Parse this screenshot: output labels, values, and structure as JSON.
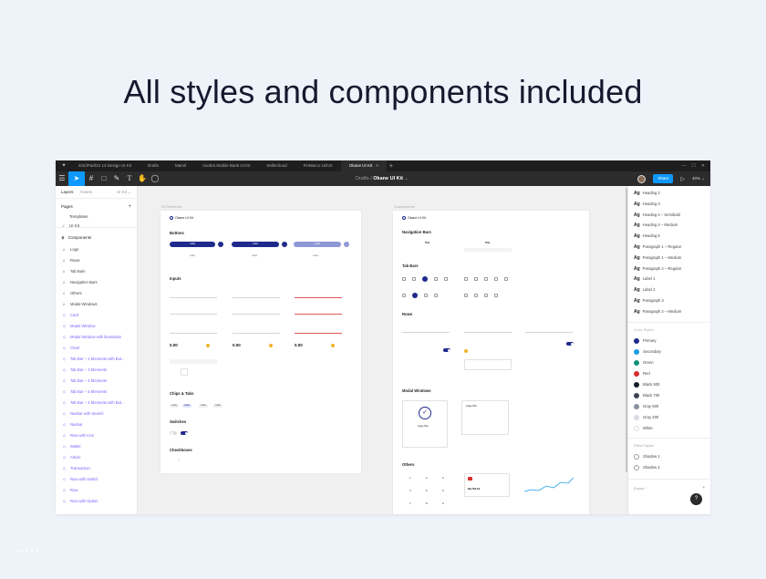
{
  "headline": "All styles and components included",
  "app": {
    "tabs": [
      {
        "label": "iOS/iPadOS 13 Design UI Kit"
      },
      {
        "label": "Drafts"
      },
      {
        "label": "Marvil"
      },
      {
        "label": "Vuokra Mobile Bank UI Kit"
      },
      {
        "label": "Sellercloud"
      },
      {
        "label": "FinMarco UI/UX"
      },
      {
        "label": "Okane UI Kit",
        "close": "×"
      }
    ],
    "tab_add": "+",
    "breadcrumb": {
      "folder": "Drafts",
      "sep": " / ",
      "file": "Okane UI Kit",
      "chevron": "⌄"
    },
    "share_label": "Share",
    "zoom": "40%",
    "accent": "#0d99ff"
  },
  "left_panel": {
    "tabs": [
      "Layers",
      "Assets"
    ],
    "kit_label": "UI Kit ⌄",
    "pages_title": "Pages",
    "pages": [
      "Templates",
      "UI Kit"
    ],
    "components_title": "Components",
    "components": [
      {
        "label": "Logo",
        "accent": false
      },
      {
        "label": "Rows",
        "accent": false
      },
      {
        "label": "Tab Bars",
        "accent": false
      },
      {
        "label": "Navigation Bars",
        "accent": false
      },
      {
        "label": "Others",
        "accent": false
      },
      {
        "label": "Modal Windows",
        "accent": false
      },
      {
        "label": "Card",
        "accent": true
      },
      {
        "label": "Modal Window",
        "accent": true
      },
      {
        "label": "Modal Window with Illustration",
        "accent": true
      },
      {
        "label": "Chart",
        "accent": true
      },
      {
        "label": "Tab Bar – 2 Elements with But...",
        "accent": true
      },
      {
        "label": "Tab Bar – 3 Elements",
        "accent": true
      },
      {
        "label": "Tab Bar – 4 Elements",
        "accent": true
      },
      {
        "label": "Tab Bar – 5 Elements",
        "accent": true
      },
      {
        "label": "Tab Bar – 4 Elements with But...",
        "accent": true
      },
      {
        "label": "Navbar with Search",
        "accent": true
      },
      {
        "label": "Navbar",
        "accent": true
      },
      {
        "label": "Row with Icon",
        "accent": true
      },
      {
        "label": "Wallet",
        "accent": true
      },
      {
        "label": "Article",
        "accent": true
      },
      {
        "label": "Transaction",
        "accent": true
      },
      {
        "label": "Row with Switch",
        "accent": true
      },
      {
        "label": "Row",
        "accent": true
      },
      {
        "label": "Row with Option",
        "accent": true
      }
    ]
  },
  "canvas": {
    "frame1": {
      "label": "UI Elements",
      "logo": "Okane UI Kit",
      "sections": [
        "Buttons",
        "Inputs",
        "Chips & Tabs",
        "Switches",
        "Checkboxes"
      ],
      "amounts": [
        "0.00",
        "0.00",
        "0.00",
        "0.00",
        "0.00",
        "0.00"
      ]
    },
    "frame2": {
      "label": "Components",
      "logo": "Okane UI Kit",
      "sections": [
        "Navigation Bars",
        "Tab Bars",
        "Rows",
        "Modal Windows",
        "Others"
      ],
      "nav_titles": [
        "Title",
        "Title"
      ],
      "modal_large_title": "Large Title",
      "balance": "$3,764.51",
      "keypad": [
        "1",
        "2",
        "3",
        "4",
        "5",
        "6",
        "7",
        "8",
        "9"
      ]
    }
  },
  "right_panel": {
    "text_styles": [
      "Heading 2",
      "Heading 3",
      "Heading 4 – Semibold",
      "Heading 4 – Medium",
      "Heading 5",
      "Paragraph 1 – Regular",
      "Paragraph 1 – Medium",
      "Paragraph 2 – Regular",
      "Label 1",
      "Label 2",
      "Paragraph 3",
      "Paragraph 2 – Medium"
    ],
    "ag": "Ag",
    "color_styles_title": "Color Styles",
    "colors": [
      {
        "name": "Primary",
        "hex": "#1f2a8c"
      },
      {
        "name": "Secondary",
        "hex": "#1e9be8"
      },
      {
        "name": "Green",
        "hex": "#14907a"
      },
      {
        "name": "Red",
        "hex": "#d92c2c"
      },
      {
        "name": "Black 900",
        "hex": "#161a2b"
      },
      {
        "name": "Black 700",
        "hex": "#3e4354"
      },
      {
        "name": "Gray 500",
        "hex": "#8b90a0"
      },
      {
        "name": "Gray 200",
        "hex": "#d9dbe2"
      },
      {
        "name": "White",
        "hex": "#ffffff"
      }
    ],
    "effect_styles_title": "Effect Styles",
    "effects": [
      "Shadow 1",
      "Shadow 2"
    ],
    "export_label": "Export",
    "help": "?"
  }
}
